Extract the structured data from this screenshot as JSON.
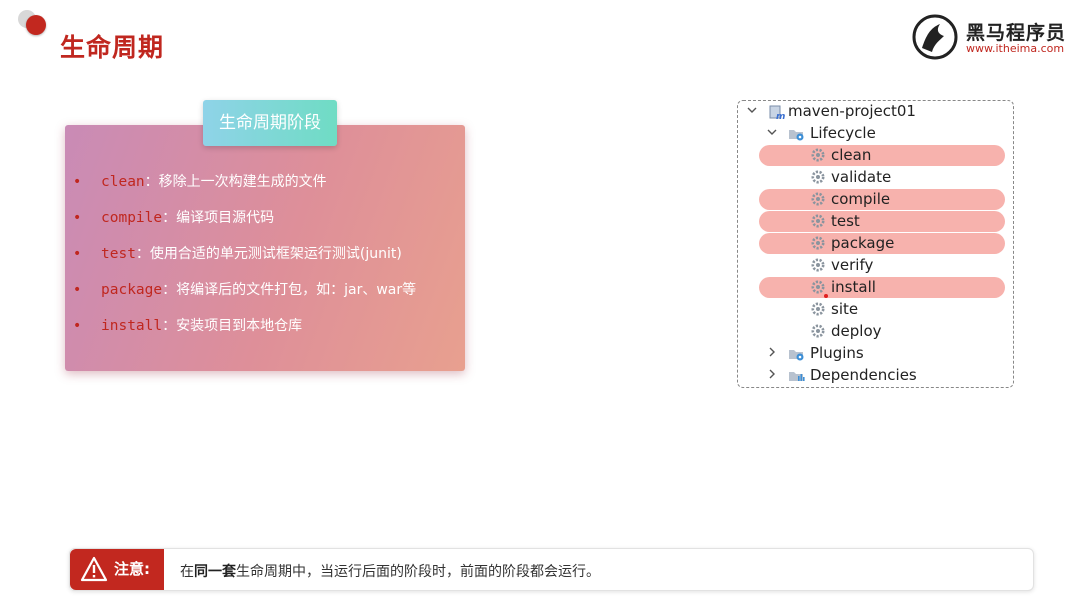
{
  "page": {
    "title": "生命周期"
  },
  "brand": {
    "name": "黑马程序员",
    "url": "www.itheima.com"
  },
  "card": {
    "tab_label": "生命周期阶段",
    "items": [
      {
        "keyword": "clean",
        "desc": "：移除上一次构建生成的文件"
      },
      {
        "keyword": "compile",
        "desc": "：编译项目源代码"
      },
      {
        "keyword": "test",
        "desc": "：使用合适的单元测试框架运行测试(junit)"
      },
      {
        "keyword": "package",
        "desc": "：将编译后的文件打包，如：jar、war等"
      },
      {
        "keyword": "install",
        "desc": "：安装项目到本地仓库"
      }
    ]
  },
  "tree": {
    "project": "maven-project01",
    "lifecycle": "Lifecycle",
    "phases": [
      {
        "label": "clean",
        "highlighted": true
      },
      {
        "label": "validate",
        "highlighted": false
      },
      {
        "label": "compile",
        "highlighted": true
      },
      {
        "label": "test",
        "highlighted": true
      },
      {
        "label": "package",
        "highlighted": true
      },
      {
        "label": "verify",
        "highlighted": false
      },
      {
        "label": "install",
        "highlighted": true
      },
      {
        "label": "site",
        "highlighted": false
      },
      {
        "label": "deploy",
        "highlighted": false
      }
    ],
    "plugins": "Plugins",
    "dependencies": "Dependencies"
  },
  "note": {
    "label": "注意:",
    "prefix": "在",
    "emphasis": "同一套",
    "suffix": "生命周期中，当运行后面的阶段时，前面的阶段都会运行。"
  },
  "colors": {
    "accent": "#c2281f",
    "highlight": "#f7b2ad",
    "tab": "#7fd8d4"
  },
  "icons": [
    "warning-icon",
    "gear-icon",
    "maven-module-icon",
    "folder-gear-icon",
    "chevron-down-icon",
    "chevron-right-icon",
    "brand-logo-icon"
  ]
}
